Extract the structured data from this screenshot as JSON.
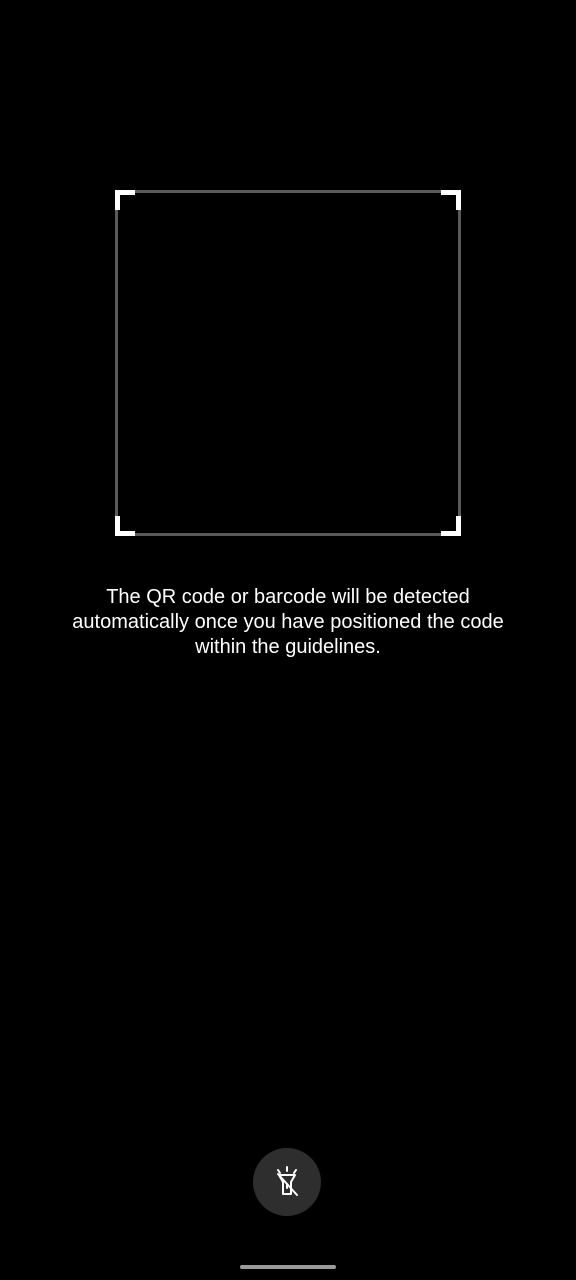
{
  "scanner": {
    "instructions": "The QR code or barcode will be detected automatically once you have positioned the code within the guidelines."
  },
  "controls": {
    "flashlight_icon": "flashlight-off-icon"
  },
  "colors": {
    "background": "#000000",
    "frame": "#5a5a5a",
    "frame_corners": "#ffffff",
    "button_background": "#2e2e2e",
    "text": "#ffffff"
  }
}
